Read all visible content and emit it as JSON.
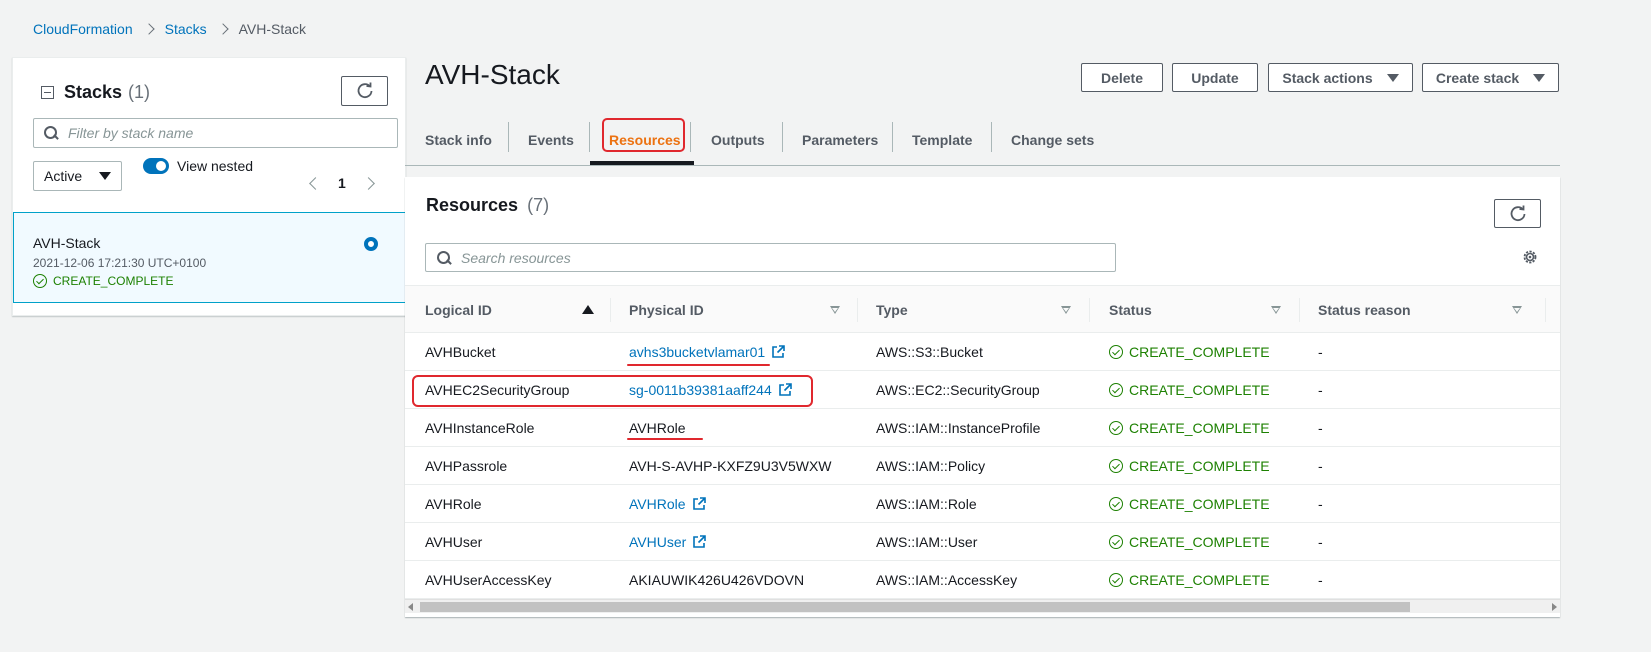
{
  "breadcrumb": {
    "items": [
      "CloudFormation",
      "Stacks"
    ],
    "current": "AVH-Stack"
  },
  "left_panel": {
    "title": "Stacks",
    "count": "(1)",
    "search_placeholder": "Filter by stack name",
    "filter_select": "Active",
    "toggle_label": "View nested",
    "toggle_on": true,
    "page": "1",
    "stack": {
      "name": "AVH-Stack",
      "date": "2021-12-06 17:21:30 UTC+0100",
      "status": "CREATE_COMPLETE"
    }
  },
  "main": {
    "title": "AVH-Stack",
    "actions": {
      "delete": "Delete",
      "update": "Update",
      "stack_actions": "Stack actions",
      "create_stack": "Create stack"
    },
    "tabs": [
      {
        "label": "Stack info"
      },
      {
        "label": "Events"
      },
      {
        "label": "Resources",
        "active": true
      },
      {
        "label": "Outputs"
      },
      {
        "label": "Parameters"
      },
      {
        "label": "Template"
      },
      {
        "label": "Change sets"
      }
    ]
  },
  "resources": {
    "title": "Resources",
    "count": "(7)",
    "search_placeholder": "Search resources",
    "columns": [
      "Logical ID",
      "Physical ID",
      "Type",
      "Status",
      "Status reason"
    ],
    "rows": [
      {
        "logical_id": "AVHBucket",
        "physical_id": "avhs3bucketvlamar01",
        "physical_link": true,
        "type": "AWS::S3::Bucket",
        "status": "CREATE_COMPLETE",
        "reason": "-"
      },
      {
        "logical_id": "AVHEC2SecurityGroup",
        "physical_id": "sg-0011b39381aaff244",
        "physical_link": true,
        "type": "AWS::EC2::SecurityGroup",
        "status": "CREATE_COMPLETE",
        "reason": "-"
      },
      {
        "logical_id": "AVHInstanceRole",
        "physical_id": "AVHRole",
        "physical_link": false,
        "type": "AWS::IAM::InstanceProfile",
        "status": "CREATE_COMPLETE",
        "reason": "-"
      },
      {
        "logical_id": "AVHPassrole",
        "physical_id": "AVH-S-AVHP-KXFZ9U3V5WXW",
        "physical_link": false,
        "type": "AWS::IAM::Policy",
        "status": "CREATE_COMPLETE",
        "reason": "-"
      },
      {
        "logical_id": "AVHRole",
        "physical_id": "AVHRole",
        "physical_link": true,
        "type": "AWS::IAM::Role",
        "status": "CREATE_COMPLETE",
        "reason": "-"
      },
      {
        "logical_id": "AVHUser",
        "physical_id": "AVHUser",
        "physical_link": true,
        "type": "AWS::IAM::User",
        "status": "CREATE_COMPLETE",
        "reason": "-"
      },
      {
        "logical_id": "AVHUserAccessKey",
        "physical_id": "AKIAUWIK426U426VDOVN",
        "physical_link": false,
        "type": "AWS::IAM::AccessKey",
        "status": "CREATE_COMPLETE",
        "reason": "-"
      }
    ]
  },
  "colors": {
    "link": "#0073bb",
    "success": "#1d8102",
    "active_tab": "#ec7211",
    "annotation": "#e0282e"
  }
}
